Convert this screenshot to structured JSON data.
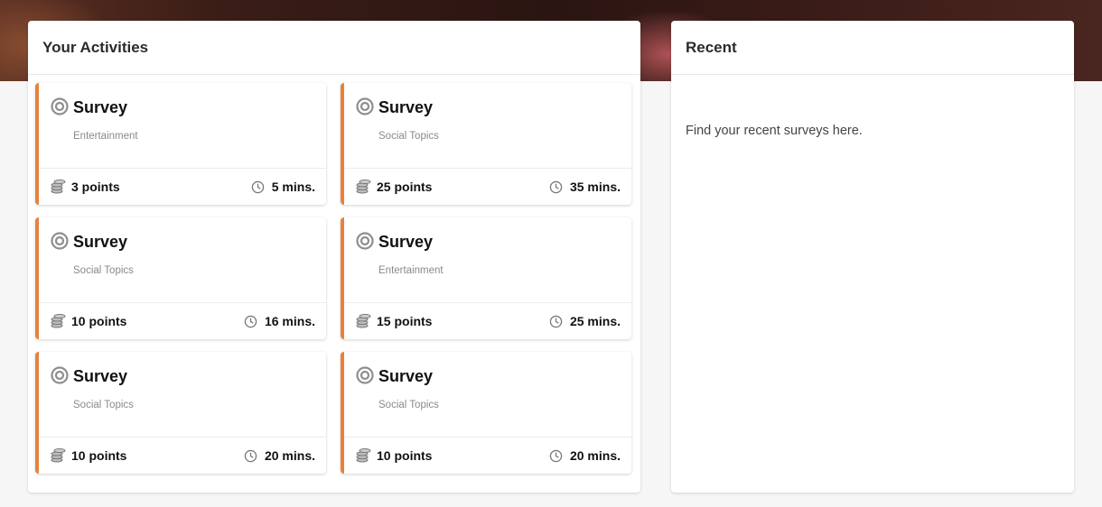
{
  "activities": {
    "title": "Your Activities",
    "cards": [
      {
        "title": "Survey",
        "category": "Entertainment",
        "points": "3 points",
        "duration": "5 mins."
      },
      {
        "title": "Survey",
        "category": "Social Topics",
        "points": "25 points",
        "duration": "35 mins."
      },
      {
        "title": "Survey",
        "category": "Social Topics",
        "points": "10 points",
        "duration": "16 mins."
      },
      {
        "title": "Survey",
        "category": "Entertainment",
        "points": "15 points",
        "duration": "25 mins."
      },
      {
        "title": "Survey",
        "category": "Social Topics",
        "points": "10 points",
        "duration": "20 mins."
      },
      {
        "title": "Survey",
        "category": "Social Topics",
        "points": "10 points",
        "duration": "20 mins."
      }
    ]
  },
  "recent": {
    "title": "Recent",
    "empty_text": "Find your recent surveys here."
  },
  "icons": {
    "card": "target-icon",
    "points": "coins-icon",
    "duration": "clock-icon"
  },
  "colors": {
    "accent": "#e8823c",
    "page_background": "#f6f6f6"
  }
}
